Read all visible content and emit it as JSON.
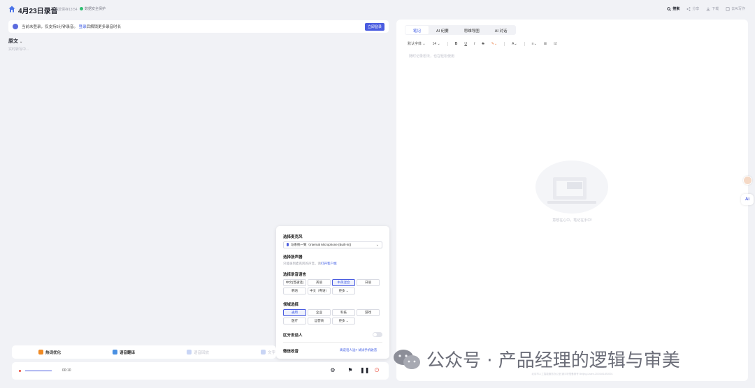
{
  "header": {
    "title": "4月23日录音",
    "saved_text": "最近保存13:54",
    "secure_text": "数据安全保护",
    "actions": [
      {
        "label": "搜索",
        "icon": "search-icon",
        "primary": true
      },
      {
        "label": "分享",
        "icon": "share-icon",
        "primary": false
      },
      {
        "label": "下载",
        "icon": "download-icon",
        "primary": false
      },
      {
        "label": "去AI写作",
        "icon": "ai-write-icon",
        "primary": false
      }
    ]
  },
  "banner": {
    "text_before": "当前未登录，仅支持5分钟录音。",
    "link": "登录",
    "text_after": "后解锁更多录音时长",
    "button": "立即登录"
  },
  "transcript": {
    "title": "原文",
    "hint": "实时转写中..."
  },
  "notes_panel": {
    "tabs": [
      "笔记",
      "AI 纪要",
      "思维导图",
      "AI 对话"
    ],
    "active_tab": 0,
    "toolbar": {
      "font": "默认字体",
      "size": "14",
      "buttons": [
        "B",
        "U",
        "I",
        "S"
      ]
    },
    "editor_placeholder": "随时记录想法，也在轻松使用",
    "empty_text": "意想在心中，笔记在手中!",
    "footer_note": "北京市人工智能服务办公室 通义听悟备案号 Beijing-Listen-20240418S0001"
  },
  "settings_popup": {
    "mic_title": "选择麦克风",
    "mic_value": "与系统一致（Internal Microphone (Built-in))",
    "speaker_title": "选择扬声器",
    "speaker_note": "只能录到麦克风的声音。请",
    "speaker_link": "打开客户端",
    "language_title": "选择录音语言",
    "languages": [
      "中文(普通话)",
      "英语",
      "中英混合",
      "日语",
      "韩语",
      "中文（粤语）",
      "更多"
    ],
    "active_language": 2,
    "domain_title": "领域选择",
    "domains": [
      "通用",
      "企业",
      "科技",
      "游戏",
      "医疗",
      "运营商",
      "更多"
    ],
    "active_domain": 0,
    "speaker_distinguish": "区分说话人",
    "wechat_label": "微信收音",
    "wechat_link": "离说话人远? 试试手机收音"
  },
  "feature_bar": [
    {
      "label": "热词优化",
      "icon": "hotword-icon",
      "color": "#f08a24",
      "enabled": true
    },
    {
      "label": "语音翻译",
      "icon": "translate-icon",
      "color": "#4a90e2",
      "enabled": true
    },
    {
      "label": "语音回放",
      "icon": "playback-icon",
      "color": "#c9d5f5",
      "enabled": false
    },
    {
      "label": "文字",
      "icon": "text-icon",
      "color": "#c9d5f5",
      "enabled": false
    }
  ],
  "player": {
    "time": "00:10"
  },
  "watermark": {
    "text": "公众号 · 产品经理的逻辑与审美"
  }
}
